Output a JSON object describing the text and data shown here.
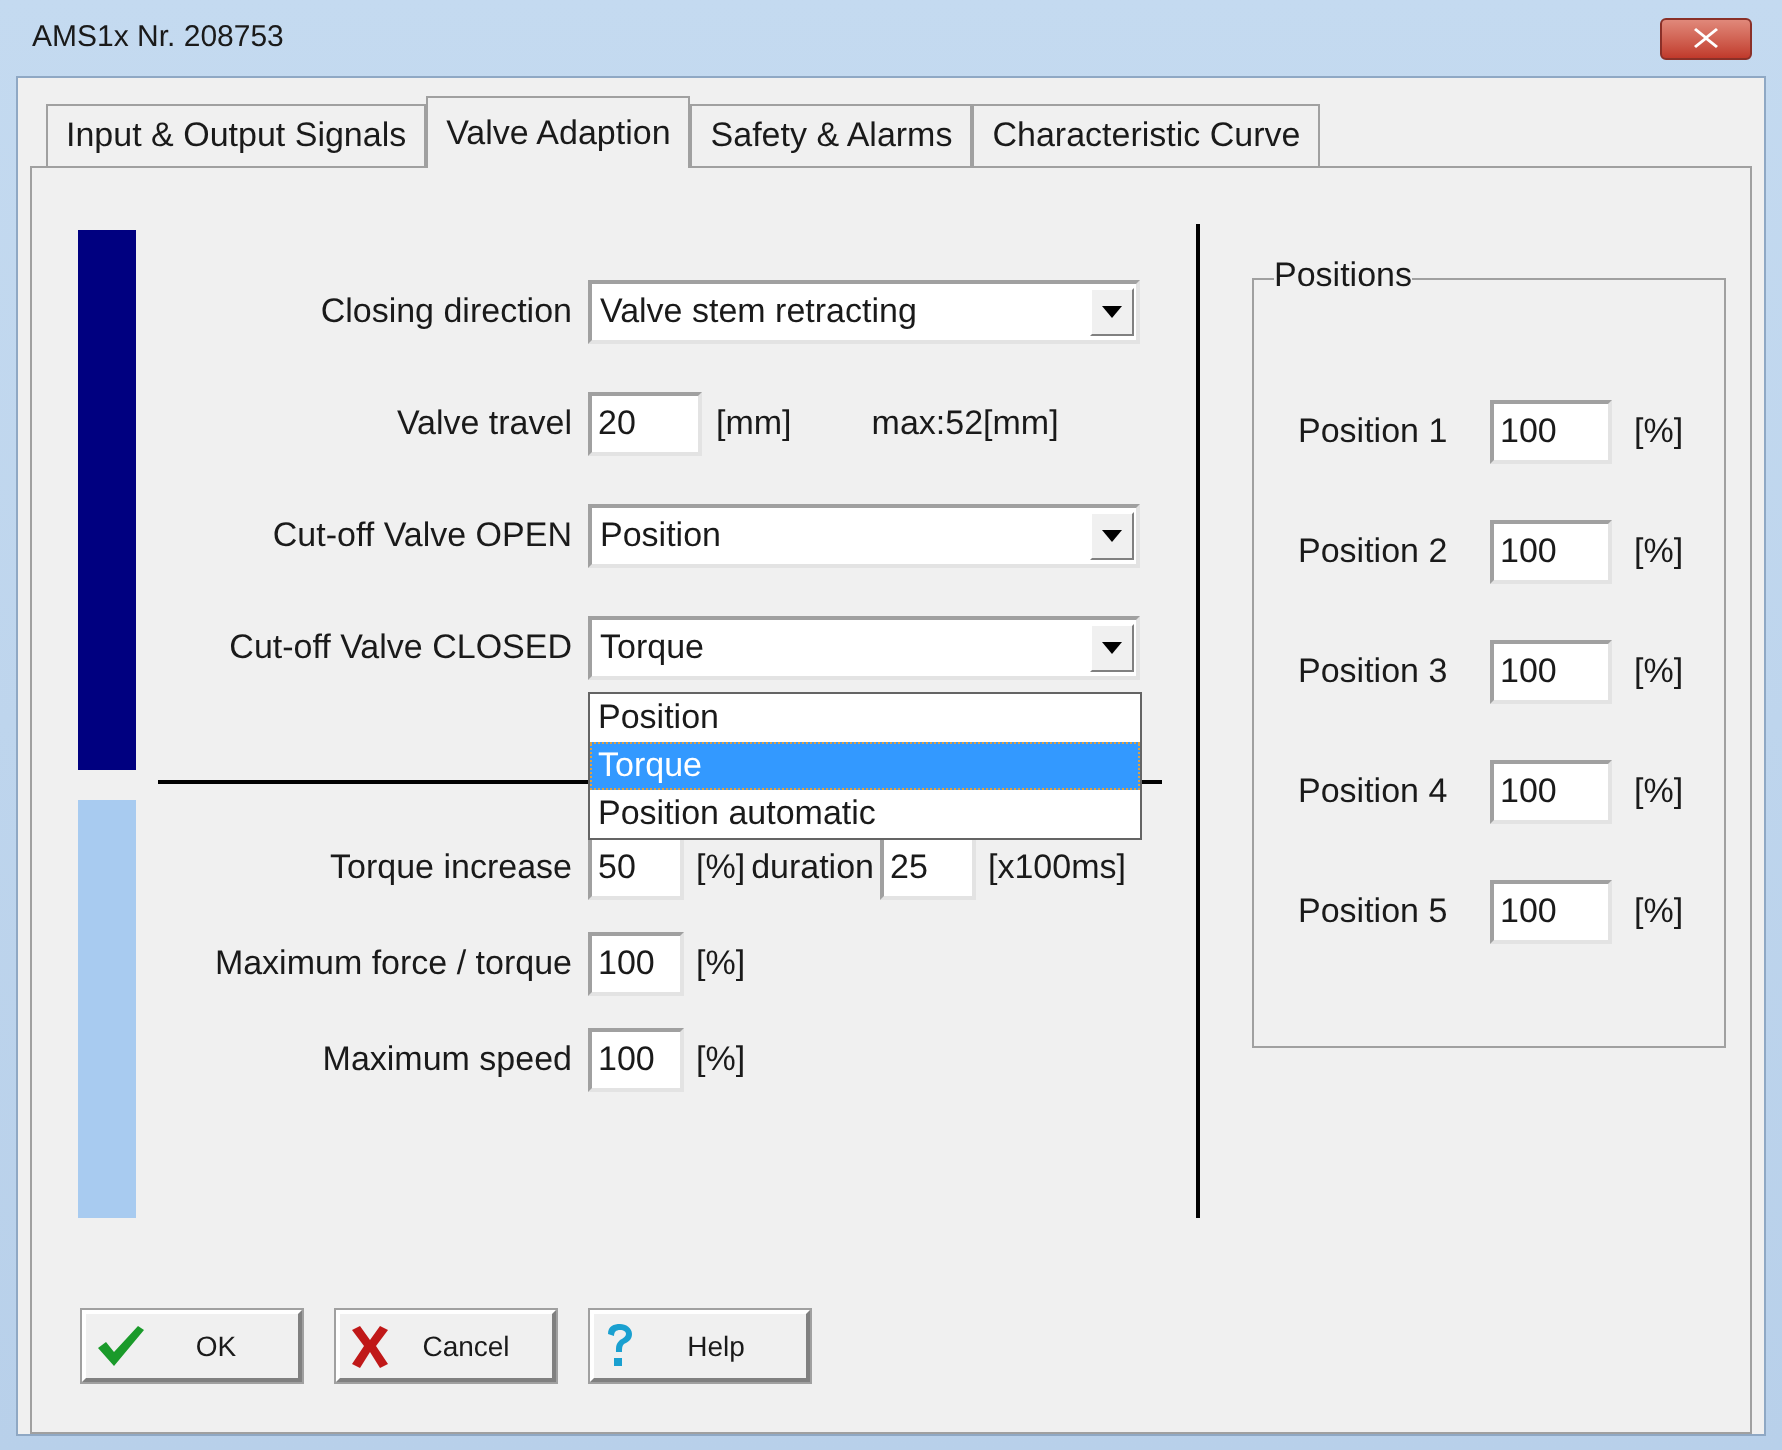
{
  "window": {
    "title": "AMS1x Nr. 208753"
  },
  "tabs": [
    {
      "label": "Input & Output Signals",
      "selected": false
    },
    {
      "label": "Valve Adaption",
      "selected": true
    },
    {
      "label": "Safety & Alarms",
      "selected": false
    },
    {
      "label": "Characteristic Curve",
      "selected": false
    }
  ],
  "fields": [
    {
      "kind": "select",
      "label": "Closing direction",
      "value": "Valve stem retracting"
    },
    {
      "kind": "number",
      "label": "Valve travel",
      "value": "20",
      "unit": "[mm]",
      "note": "max:52[mm]"
    },
    {
      "kind": "select",
      "label": "Cut-off Valve OPEN",
      "value": "Position"
    },
    {
      "kind": "select",
      "label": "Cut-off Valve CLOSED",
      "value": "Torque",
      "expanded": true,
      "options": [
        {
          "label": "Position",
          "selected": false
        },
        {
          "label": "Torque",
          "selected": true
        },
        {
          "label": "Position automatic",
          "selected": false
        }
      ]
    }
  ],
  "limits": [
    {
      "label": "Torque increase",
      "value": "50",
      "unit": "[%]",
      "extra_label": "duration",
      "extra_value": "25",
      "extra_unit": "[x100ms]"
    },
    {
      "label": "Maximum force / torque",
      "value": "100",
      "unit": "[%]"
    },
    {
      "label": "Maximum speed",
      "value": "100",
      "unit": "[%]"
    }
  ],
  "positions": {
    "title": "Positions",
    "items": [
      {
        "label": "Position 1",
        "value": "100",
        "unit": "[%]"
      },
      {
        "label": "Position 2",
        "value": "100",
        "unit": "[%]"
      },
      {
        "label": "Position 3",
        "value": "100",
        "unit": "[%]"
      },
      {
        "label": "Position 4",
        "value": "100",
        "unit": "[%]"
      },
      {
        "label": "Position 5",
        "value": "100",
        "unit": "[%]"
      }
    ]
  },
  "buttons": [
    {
      "kind": "ok",
      "label": "OK"
    },
    {
      "kind": "cancel",
      "label": "Cancel"
    },
    {
      "kind": "help",
      "label": "Help"
    }
  ]
}
